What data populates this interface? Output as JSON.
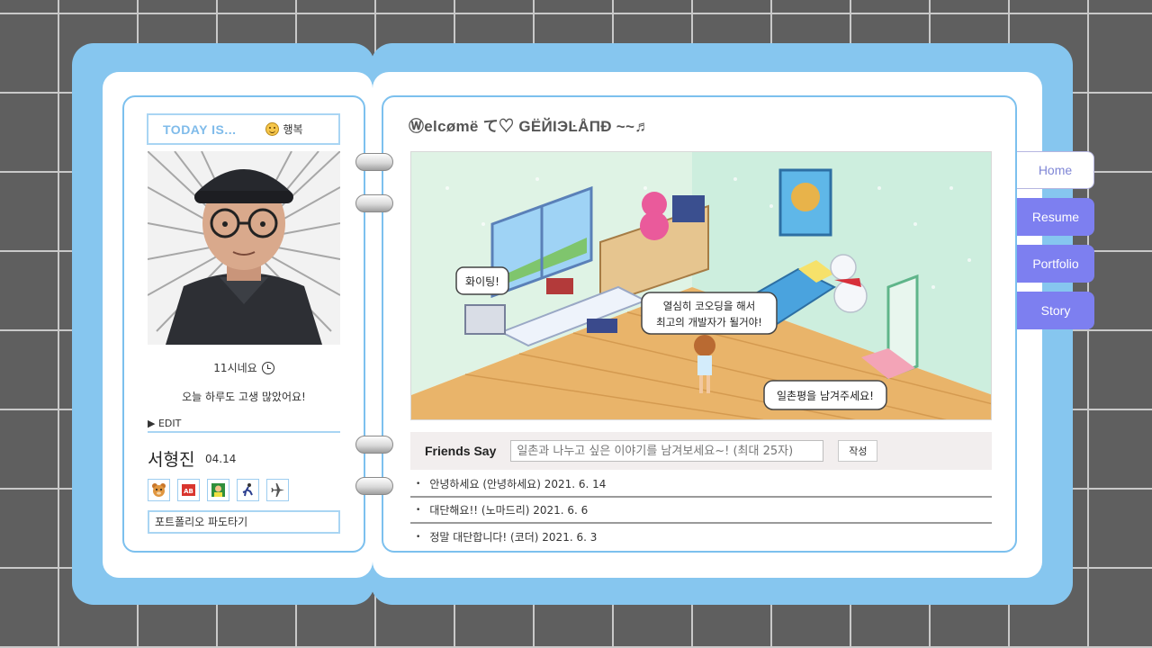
{
  "left": {
    "today_label": "TODAY IS...",
    "mood": "행복",
    "time_text": "11시네요",
    "greeting": "오늘 하루도 고생 많았어요!",
    "edit_label": "▶ EDIT",
    "name": "서형진",
    "birthday": "04.14",
    "portfolio_link": "포트폴리오 파도타기"
  },
  "right": {
    "welcome_title": "Ⓦelcømë て♡ GËЙIЭĿÅПÐ ~~♬",
    "scene_bubbles": {
      "fighting": "화이팅!",
      "coding_line1": "열심히 코오딩을 해서",
      "coding_line2": "최고의 개발자가 될거야!",
      "guestbook": "일촌평을 남겨주세요!"
    },
    "friends_say": {
      "label": "Friends Say",
      "placeholder": "일촌과 나누고 싶은 이야기를 남겨보세요~! (최대 25자)",
      "submit_label": "작성"
    },
    "comments": [
      {
        "text": "안녕하세요 (안녕하세요) 2021. 6. 14"
      },
      {
        "text": "대단해요!! (노마드리) 2021. 6. 6"
      },
      {
        "text": "정말 대단합니다! (코더) 2021. 6. 3"
      }
    ]
  },
  "tabs": [
    {
      "label": "Home",
      "active": true
    },
    {
      "label": "Resume",
      "active": false
    },
    {
      "label": "Portfolio",
      "active": false
    },
    {
      "label": "Story",
      "active": false
    }
  ],
  "colors": {
    "book_blue": "#86c6ef",
    "border_blue": "#7cc0ee",
    "tab_purple": "#7d7ff0",
    "grid_bg": "#5f5f5f"
  }
}
